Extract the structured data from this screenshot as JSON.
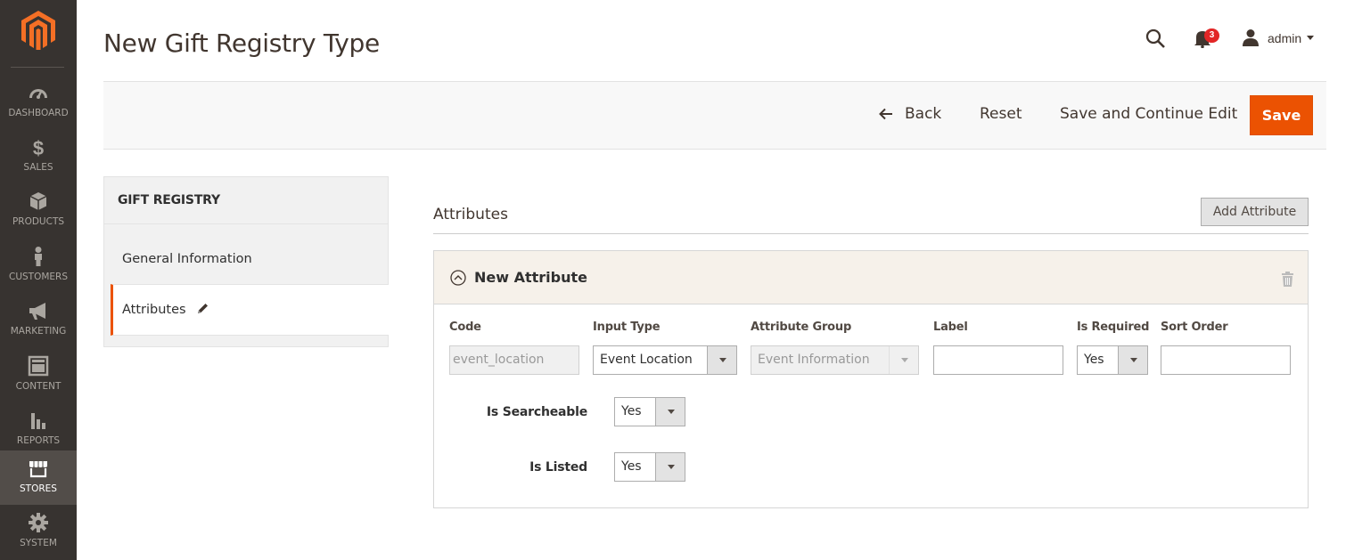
{
  "sidebar": {
    "logo": "magento-logo",
    "items": [
      {
        "label": "DASHBOARD",
        "icon": "dashboard-icon"
      },
      {
        "label": "SALES",
        "icon": "dollar-icon"
      },
      {
        "label": "PRODUCTS",
        "icon": "box-icon"
      },
      {
        "label": "CUSTOMERS",
        "icon": "person-icon"
      },
      {
        "label": "MARKETING",
        "icon": "megaphone-icon"
      },
      {
        "label": "CONTENT",
        "icon": "layout-icon"
      },
      {
        "label": "REPORTS",
        "icon": "bar-chart-icon"
      },
      {
        "label": "STORES",
        "icon": "store-icon",
        "active": true
      },
      {
        "label": "SYSTEM",
        "icon": "gear-icon"
      }
    ]
  },
  "header": {
    "title": "New Gift Registry Type",
    "notification_count": "3",
    "username": "admin"
  },
  "actions": {
    "back": "Back",
    "reset": "Reset",
    "save_continue": "Save and Continue Edit",
    "save": "Save"
  },
  "tabs": {
    "title": "GIFT REGISTRY",
    "items": [
      {
        "label": "General Information"
      },
      {
        "label": "Attributes",
        "active": true
      }
    ]
  },
  "attributes_section": {
    "title": "Attributes",
    "add_button": "Add Attribute",
    "attribute": {
      "title": "New Attribute",
      "columns": {
        "code": "Code",
        "input_type": "Input Type",
        "attribute_group": "Attribute Group",
        "label": "Label",
        "is_required": "Is Required",
        "sort_order": "Sort Order"
      },
      "values": {
        "code": "event_location",
        "input_type": "Event Location",
        "attribute_group": "Event Information",
        "label": "",
        "is_required": "Yes",
        "sort_order": ""
      },
      "is_searcheable_label": "Is Searcheable",
      "is_searcheable_value": "Yes",
      "is_listed_label": "Is Listed",
      "is_listed_value": "Yes"
    }
  },
  "colors": {
    "accent": "#eb5202",
    "sidebar_bg": "#373330",
    "sidebar_active": "#524d49",
    "badge": "#e22626"
  }
}
